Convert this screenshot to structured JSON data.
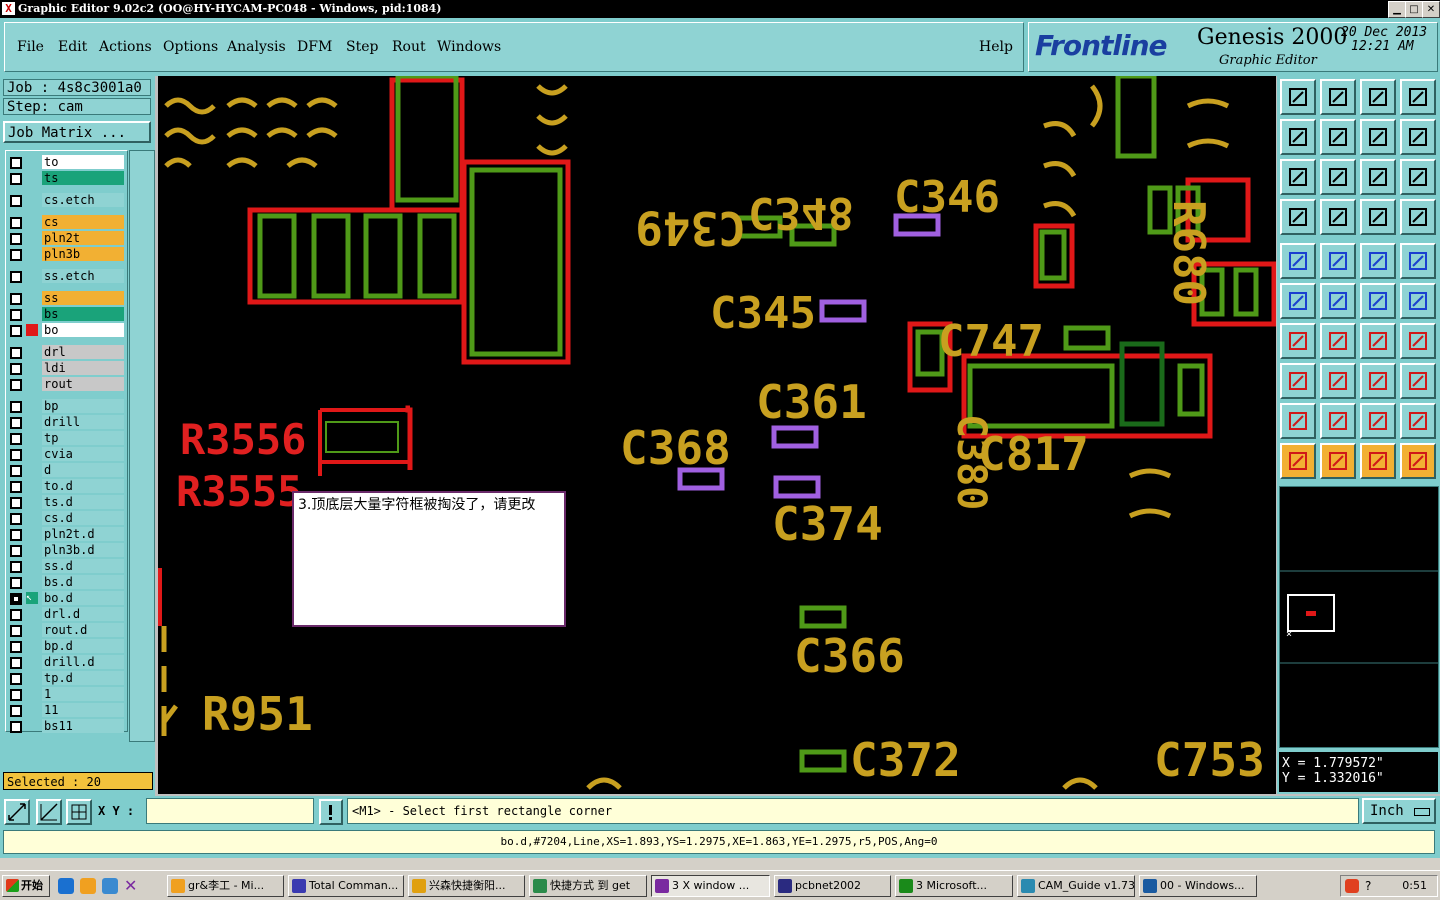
{
  "window": {
    "title": "Graphic Editor 9.02c2 (OO@HY-HYCAM-PC048 - Windows, pid:1084)"
  },
  "menu": {
    "items": [
      "File",
      "Edit",
      "Actions",
      "Options",
      "Analysis",
      "DFM",
      "Step",
      "Rout",
      "Windows"
    ],
    "help": "Help"
  },
  "brand": {
    "logo": "Frontline",
    "product": "Genesis 2000",
    "subtitle": "Graphic Editor",
    "date": "20 Dec 2013",
    "time": "12:21 AM"
  },
  "job": {
    "job_line": "Job : 4s8c3001a0",
    "step_line": "Step: cam",
    "matrix_button": "Job Matrix ..."
  },
  "layers": [
    {
      "name": "to",
      "color": "#ffffff"
    },
    {
      "name": "ts",
      "color": "#1aa37a"
    },
    {
      "name": "cs.etch",
      "color": "#8fd3d3"
    },
    {
      "name": "cs",
      "color": "#f2b033"
    },
    {
      "name": "pln2t",
      "color": "#f2b033"
    },
    {
      "name": "pln3b",
      "color": "#f2b033"
    },
    {
      "name": "ss.etch",
      "color": "#8fd3d3"
    },
    {
      "name": "ss",
      "color": "#f2b033"
    },
    {
      "name": "bs",
      "color": "#1aa37a"
    },
    {
      "name": "bo",
      "color": "#ffffff",
      "affected": true
    },
    {
      "name": "drl",
      "color": "#c8c8c8"
    },
    {
      "name": "ldi",
      "color": "#c8c8c8"
    },
    {
      "name": "rout",
      "color": "#c8c8c8"
    },
    {
      "name": "bp",
      "color": "#8fd3d3"
    },
    {
      "name": "drill",
      "color": "#8fd3d3"
    },
    {
      "name": "tp",
      "color": "#8fd3d3"
    },
    {
      "name": "cvia",
      "color": "#8fd3d3"
    },
    {
      "name": "d",
      "color": "#8fd3d3"
    },
    {
      "name": "to.d",
      "color": "#8fd3d3"
    },
    {
      "name": "ts.d",
      "color": "#8fd3d3"
    },
    {
      "name": "cs.d",
      "color": "#8fd3d3"
    },
    {
      "name": "pln2t.d",
      "color": "#8fd3d3"
    },
    {
      "name": "pln3b.d",
      "color": "#8fd3d3"
    },
    {
      "name": "ss.d",
      "color": "#8fd3d3"
    },
    {
      "name": "bs.d",
      "color": "#8fd3d3"
    },
    {
      "name": "bo.d",
      "color": "#8fd3d3",
      "work": true
    },
    {
      "name": "drl.d",
      "color": "#8fd3d3"
    },
    {
      "name": "rout.d",
      "color": "#8fd3d3"
    },
    {
      "name": "bp.d",
      "color": "#8fd3d3"
    },
    {
      "name": "drill.d",
      "color": "#8fd3d3"
    },
    {
      "name": "tp.d",
      "color": "#8fd3d3"
    },
    {
      "name": "1",
      "color": "#8fd3d3"
    },
    {
      "name": "11",
      "color": "#8fd3d3"
    },
    {
      "name": "bs11",
      "color": "#8fd3d3"
    }
  ],
  "selected": "Selected : 20",
  "note": "3.顶底层大量字符框被掏没了，请更改",
  "canvas_labels": [
    {
      "text": "C348",
      "color": "#c8a020"
    },
    {
      "text": "C349",
      "color": "#c8a020"
    },
    {
      "text": "C346",
      "color": "#c8a020"
    },
    {
      "text": "C345",
      "color": "#c8a020"
    },
    {
      "text": "C361",
      "color": "#c8a020"
    },
    {
      "text": "C368",
      "color": "#c8a020"
    },
    {
      "text": "C374",
      "color": "#c8a020"
    },
    {
      "text": "C366",
      "color": "#c8a020"
    },
    {
      "text": "C372",
      "color": "#c8a020"
    },
    {
      "text": "C753",
      "color": "#c8a020"
    },
    {
      "text": "C817",
      "color": "#c8a020"
    },
    {
      "text": "C747",
      "color": "#c8a020"
    },
    {
      "text": "C380",
      "color": "#c8a020"
    },
    {
      "text": "R951",
      "color": "#c8a020"
    },
    {
      "text": "R680",
      "color": "#c8a020"
    },
    {
      "text": "R3556",
      "color": "#e02020"
    },
    {
      "text": "R3555",
      "color": "#e02020"
    }
  ],
  "coords": {
    "x": "X = 1.779572\"",
    "y": "Y = 1.332016\""
  },
  "command": {
    "xy_label": "X Y :",
    "xy_value": "",
    "prompt": "<M1> - Select first rectangle corner",
    "units": "Inch"
  },
  "status": "bo.d,#7204,Line,XS=1.893,YS=1.2975,XE=1.863,YE=1.2975,r5,POS,Ang=0",
  "taskbar": {
    "start": "开始",
    "tasks": [
      "gr&李工 - Mi...",
      "Total Comman...",
      "兴森快捷衡阳...",
      "快捷方式 到 get",
      "3 X window ...",
      "pcbnet2002",
      "3 Microsoft...",
      "CAM_Guide v1.73",
      "00 - Windows..."
    ],
    "clock": "0:51"
  },
  "icons": {
    "toolbar": [
      "zoom-home-icon",
      "zoom-in-icon",
      "home-icon",
      "window-icon",
      "pan-left-icon",
      "pan-right-icon",
      "zoom-fit-icon",
      "zoom-back-icon",
      "zoom-extents-icon",
      "zoom-center-icon",
      "scale-1-2-icon",
      "help-query-icon",
      "properties-icon",
      "grid-icon",
      "snap-icon",
      "snap-alt-icon",
      "pad-icon",
      "move-icon",
      "ruler-icon",
      "circle-icon",
      "connect-icon",
      "delete-icon",
      "copy-icon",
      "resize-icon",
      "line-icon",
      "line-alt-icon",
      "arc-icon",
      "mirror-icon",
      "point-icon",
      "segment-icon",
      "measure-icon",
      "group-icon",
      "polygon-icon",
      "polygon-alt-icon",
      "polygon-fill-icon",
      "polygon-cut-icon",
      "pointer-icon",
      "select-icon",
      "select-alt-icon",
      "route-icon"
    ]
  }
}
